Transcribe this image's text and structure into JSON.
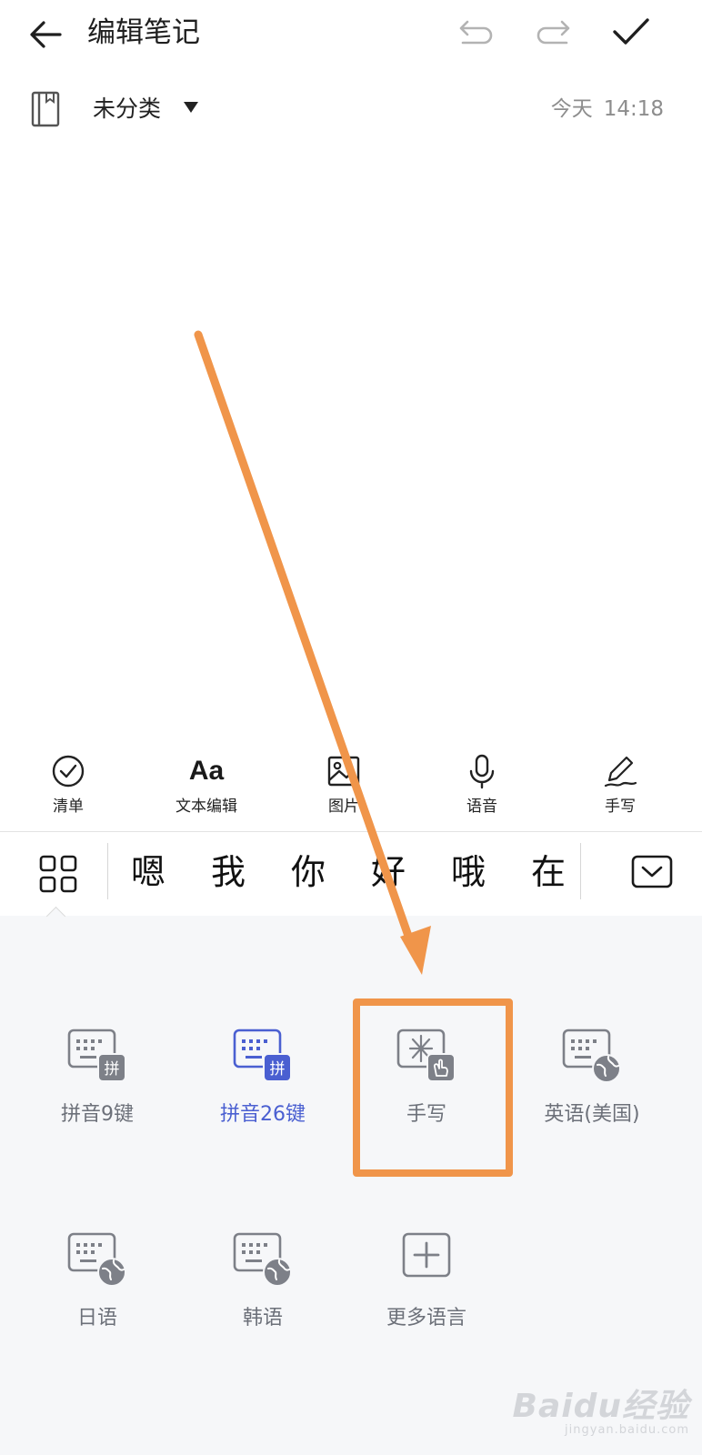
{
  "header": {
    "title": "编辑笔记"
  },
  "category": {
    "label": "未分类",
    "date": "今天",
    "time": "14:18"
  },
  "toolbar": {
    "checklist": "清单",
    "text_edit_icon": "Aa",
    "text_edit": "文本编辑",
    "image": "图片",
    "voice": "语音",
    "handwrite": "手写"
  },
  "candidates": [
    "嗯",
    "我",
    "你",
    "好",
    "哦",
    "在"
  ],
  "keyboards": {
    "pinyin9": "拼音9键",
    "pinyin9_badge": "拼",
    "pinyin26": "拼音26键",
    "pinyin26_badge": "拼",
    "handwriting": "手写",
    "english_us": "英语(美国)",
    "japanese": "日语",
    "korean": "韩语",
    "more_languages": "更多语言"
  },
  "watermark": {
    "main": "Baidu经验",
    "sub": "jingyan.baidu.com"
  },
  "colors": {
    "accent": "#4a5fd1",
    "annotation": "#f0954a",
    "icon_gray": "#7d8088"
  }
}
